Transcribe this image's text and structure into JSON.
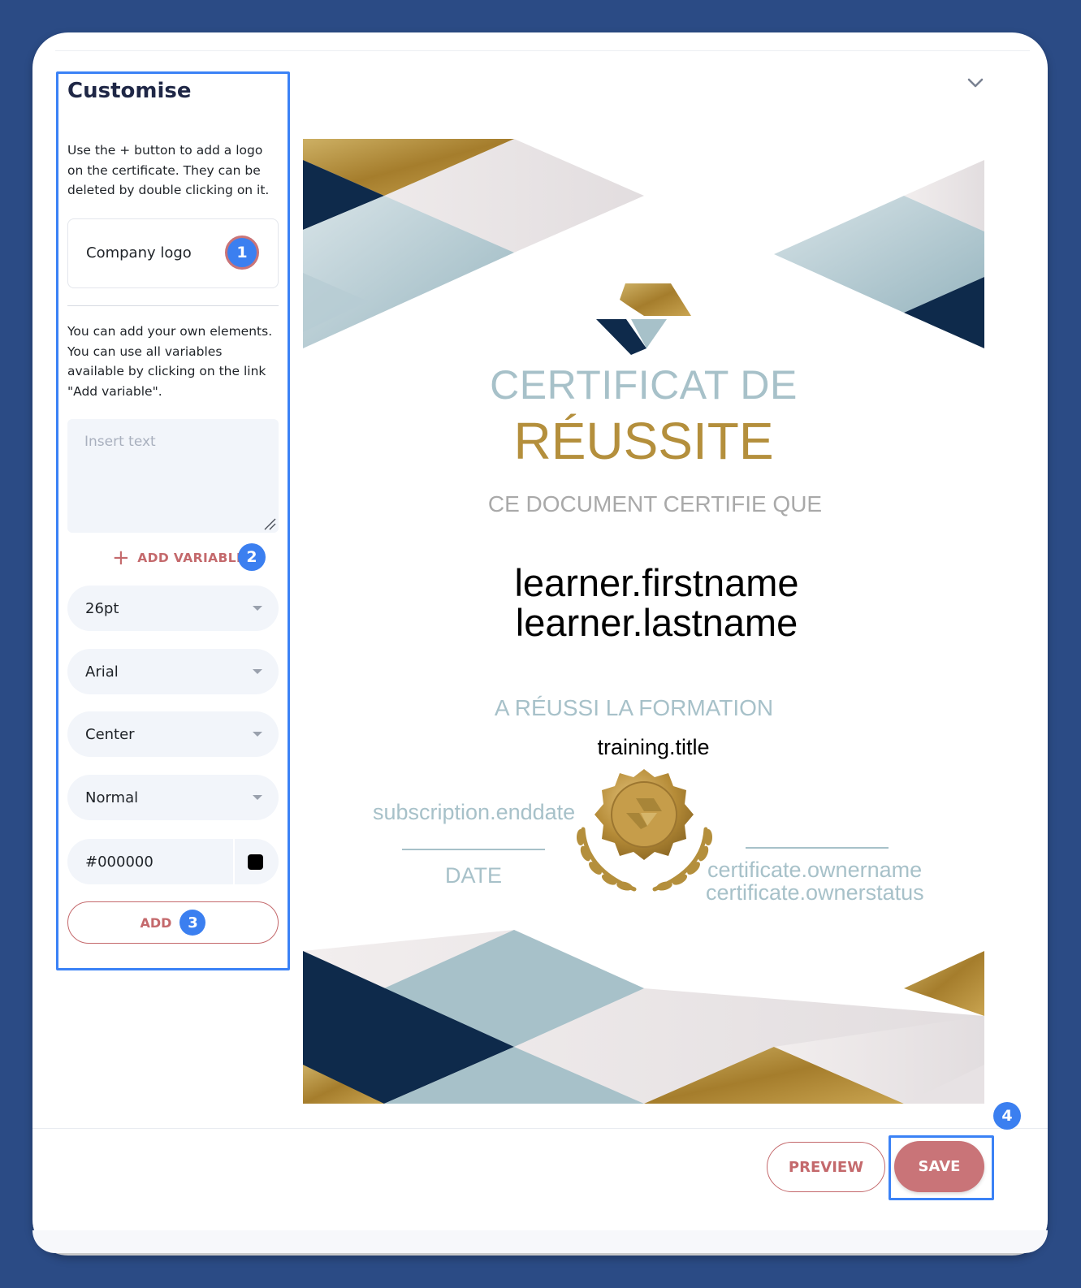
{
  "panel": {
    "title": "Customise",
    "help_logo": "Use the + button to add a logo on the certificate. They can be deleted by double clicking on it.",
    "logo_label": "Company logo",
    "help_elements": "You can add your own elements. You can use all variables available by clicking on the link \"Add variable\".",
    "text_placeholder": "Insert text",
    "add_variable_label": "ADD VARIABLE",
    "font_size": "26pt",
    "font_family": "Arial",
    "alignment": "Center",
    "font_weight": "Normal",
    "color_value": "#000000",
    "add_label": "ADD"
  },
  "badges": {
    "b1": "1",
    "b2": "2",
    "b3": "3",
    "b4": "4"
  },
  "certificate": {
    "title_line1": "CERTIFICAT DE",
    "title_line2": "RÉUSSITE",
    "certifies": "CE DOCUMENT CERTIFIE QUE",
    "firstname": "learner.firstname",
    "lastname": "learner.lastname",
    "passed": "A RÉUSSI LA FORMATION",
    "training": "training.title",
    "enddate": "subscription.enddate",
    "date_label": "DATE",
    "ownername": "certificate.ownername",
    "ownerstatus": "certificate.ownerstatus"
  },
  "footer": {
    "preview_label": "PREVIEW",
    "save_label": "SAVE"
  },
  "colors": {
    "accent": "#c4696c",
    "highlight": "#3b82f6",
    "gold": "#b48f3c",
    "steel": "#a7c1c9",
    "navy": "#0e2a4b",
    "background": "#2b4b85"
  },
  "icons": [
    "chevron-down-icon",
    "plus-icon",
    "resize-grip-icon",
    "color-swatch-icon",
    "caret-down-icon",
    "certificate-logo",
    "gold-seal"
  ]
}
